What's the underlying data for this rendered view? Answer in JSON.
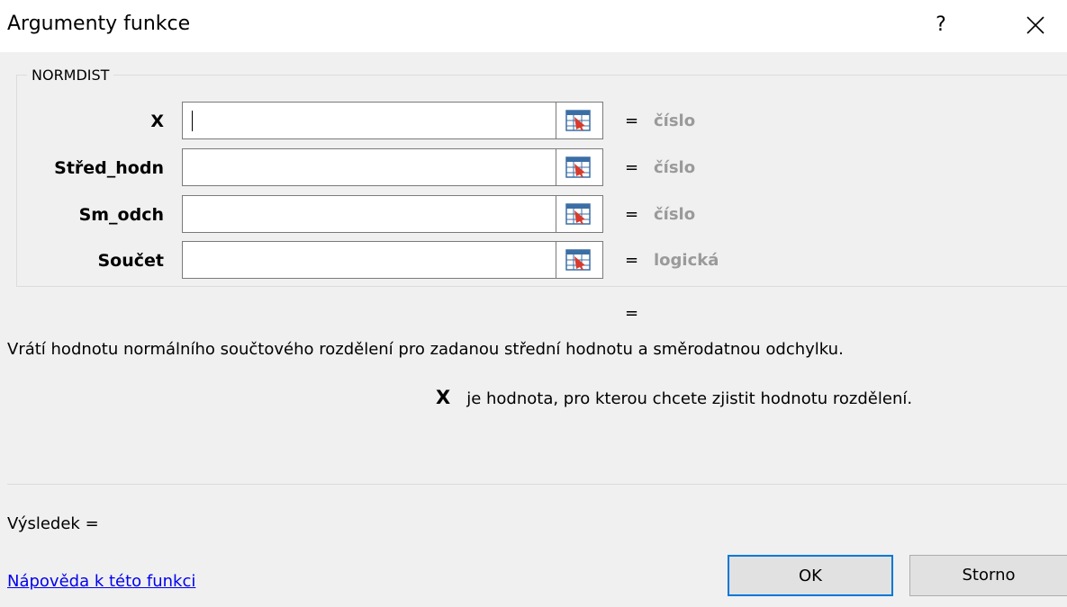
{
  "window": {
    "title": "Argumenty funkce",
    "help_label": "?"
  },
  "function_group": {
    "name": "NORMDIST",
    "arguments": [
      {
        "label": "X",
        "value": "",
        "result": "číslo"
      },
      {
        "label": "Střed_hodn",
        "value": "",
        "result": "číslo"
      },
      {
        "label": "Sm_odch",
        "value": "",
        "result": "číslo"
      },
      {
        "label": "Součet",
        "value": "",
        "result": "logická"
      }
    ],
    "equals": "="
  },
  "formula_result_equals": "=",
  "description": "Vrátí hodnotu normálního součtového rozdělení pro zadanou střední hodnotu a směrodatnou odchylku.",
  "arg_help": {
    "name": "X",
    "text": "je hodnota, pro kterou chcete zjistit hodnotu rozdělení."
  },
  "result_label": "Výsledek =",
  "help_link": "Nápověda k této funkci",
  "buttons": {
    "ok": "OK",
    "cancel": "Storno"
  },
  "colors": {
    "background": "#f0f0f0",
    "accent": "#0078d7",
    "link": "#0000ee",
    "muted": "#9a9a9a"
  },
  "icons": {
    "help": "question-mark-icon",
    "close": "close-icon",
    "range_select": "range-select-icon"
  }
}
